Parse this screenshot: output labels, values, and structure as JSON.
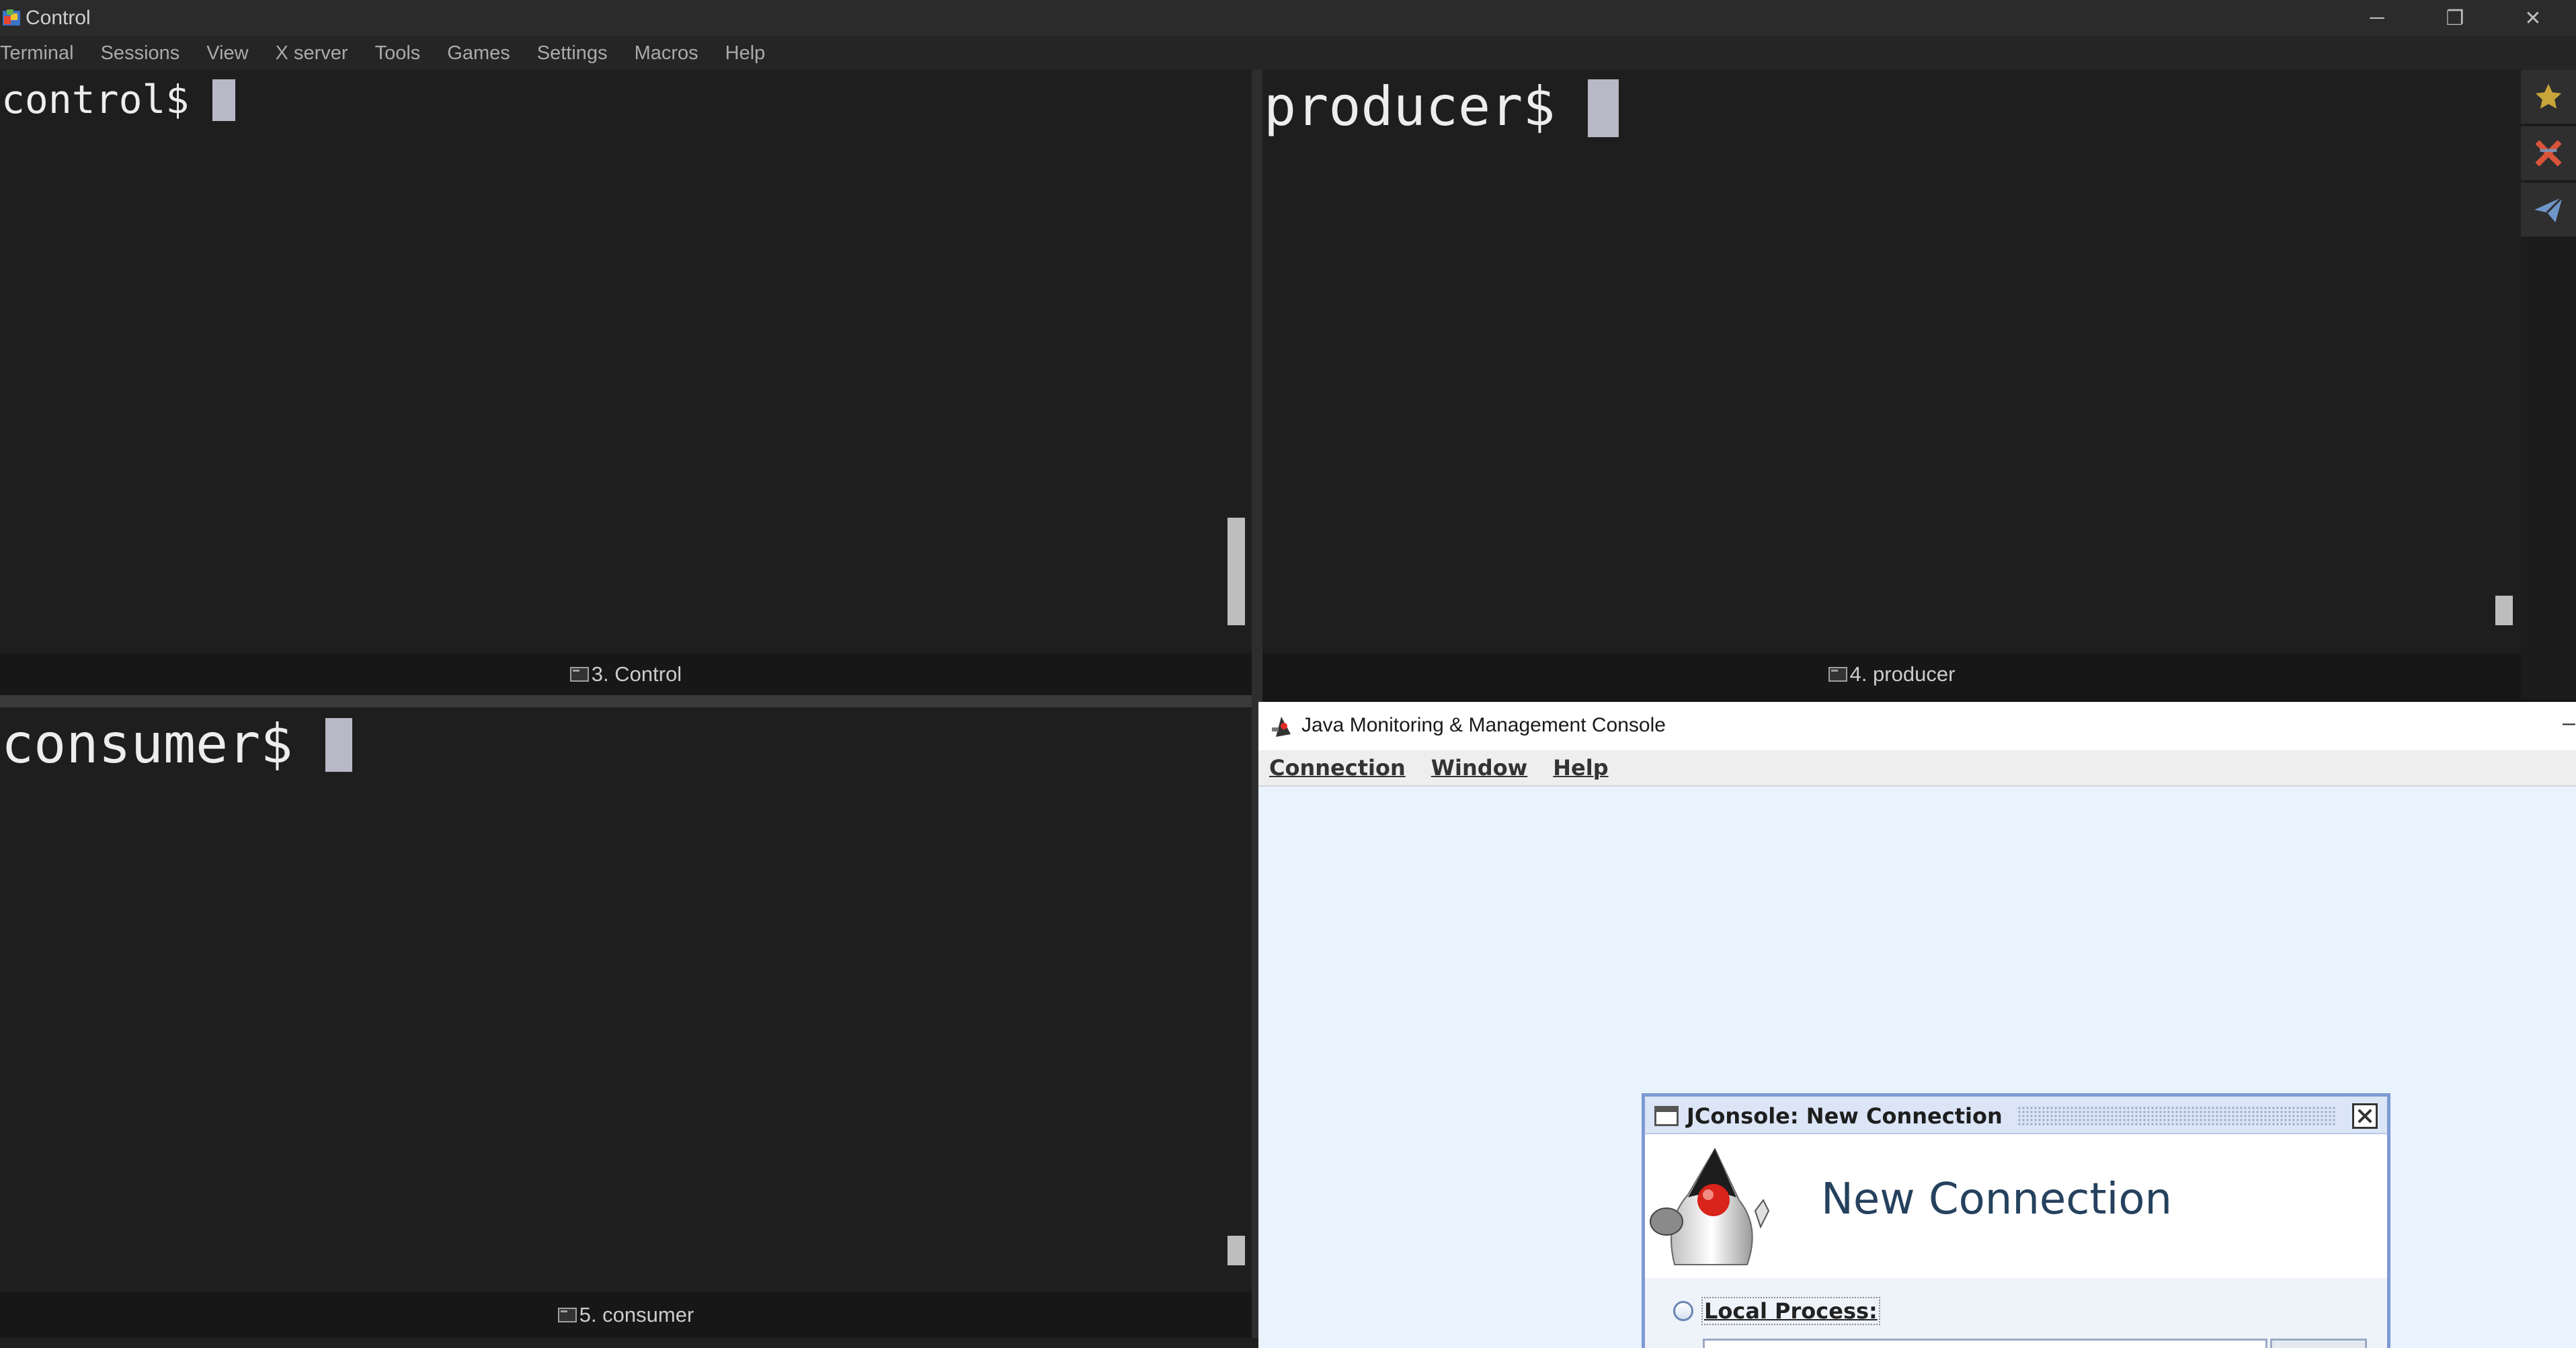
{
  "window": {
    "title": "Control",
    "buttons": {
      "minimize": "─",
      "maximize": "❐",
      "close": "✕"
    }
  },
  "menubar": {
    "items": [
      "Terminal",
      "Sessions",
      "View",
      "X server",
      "Tools",
      "Games",
      "Settings",
      "Macros",
      "Help"
    ]
  },
  "panes": [
    {
      "prompt": "control$ ",
      "tab": "3. Control"
    },
    {
      "prompt": "producer$ ",
      "tab": "4. producer"
    },
    {
      "prompt": "consumer$ ",
      "tab": "5. consumer"
    }
  ],
  "sidebar_tools": [
    "star-icon",
    "x-server-icon",
    "send-icon"
  ],
  "jconsole": {
    "window_title": "Java Monitoring & Management Console",
    "menus": [
      "Connection",
      "Window",
      "Help"
    ],
    "dialog": {
      "title": "JConsole: New Connection",
      "heading": "New Connection",
      "local_process_label": "Local Process:"
    }
  },
  "colors": {
    "terminal_bg": "#1e1e1e",
    "cursor": "#b8b8c6",
    "jconsole_bg": "#e9f3fd",
    "dialog_border": "#7d9ad2",
    "star": "#c8a53a",
    "send": "#6f96c9",
    "xserver": "#d9533a"
  }
}
